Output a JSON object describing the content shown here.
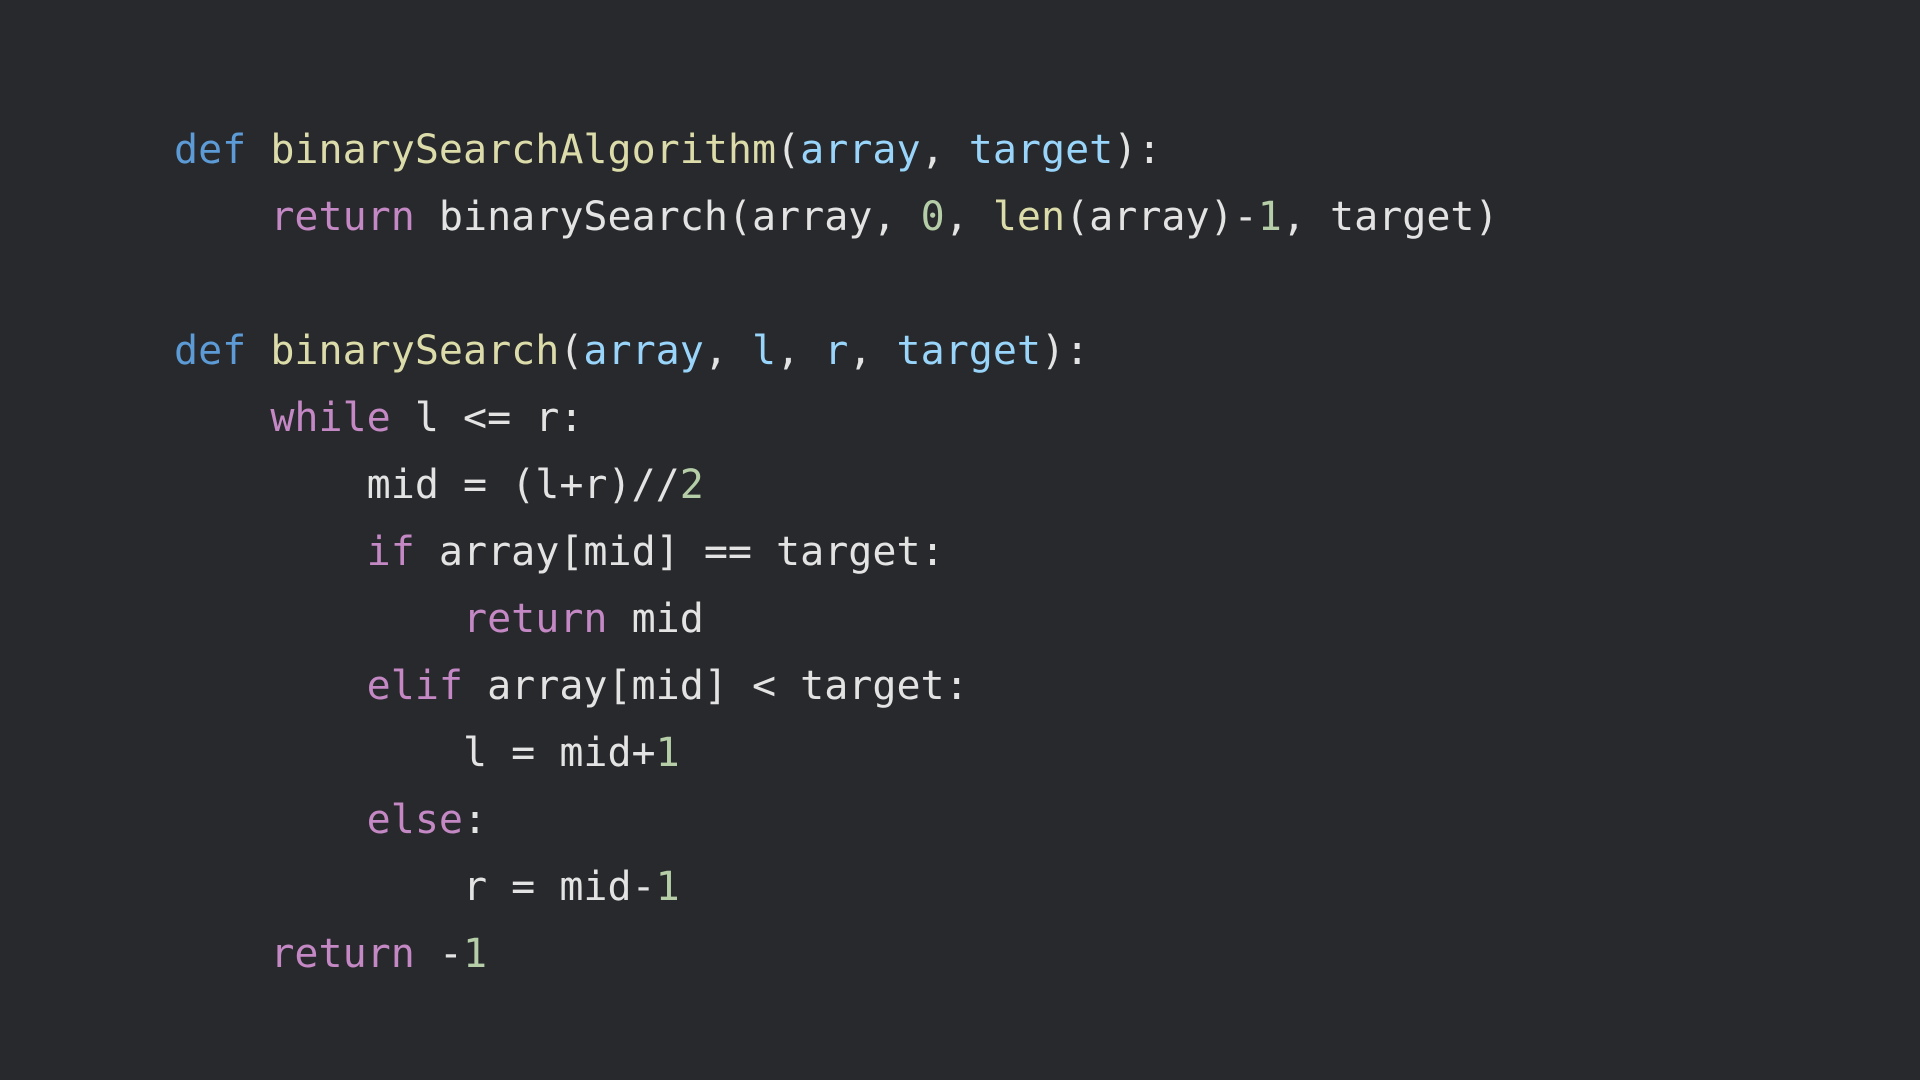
{
  "colors": {
    "background": "#28292c",
    "keyword_def": "#5d9bd6",
    "keyword_control": "#c488c5",
    "function_name": "#dcdcaa",
    "parameter": "#99d5fb",
    "number": "#b5cea8",
    "plain_text": "#e3e3e3"
  },
  "code": {
    "language": "python",
    "lines": [
      {
        "indent": 0,
        "tokens": [
          {
            "t": "def",
            "k": "kw-def"
          },
          {
            "t": " ",
            "k": "plain"
          },
          {
            "t": "binarySearchAlgorithm",
            "k": "fn"
          },
          {
            "t": "(",
            "k": "plain"
          },
          {
            "t": "array",
            "k": "param"
          },
          {
            "t": ", ",
            "k": "plain"
          },
          {
            "t": "target",
            "k": "param"
          },
          {
            "t": "):",
            "k": "plain"
          }
        ]
      },
      {
        "indent": 1,
        "tokens": [
          {
            "t": "return",
            "k": "kw"
          },
          {
            "t": " binarySearch(array, ",
            "k": "plain"
          },
          {
            "t": "0",
            "k": "num"
          },
          {
            "t": ", ",
            "k": "plain"
          },
          {
            "t": "len",
            "k": "fn"
          },
          {
            "t": "(array)-",
            "k": "plain"
          },
          {
            "t": "1",
            "k": "num"
          },
          {
            "t": ", target)",
            "k": "plain"
          }
        ]
      },
      {
        "indent": 0,
        "tokens": []
      },
      {
        "indent": 0,
        "tokens": [
          {
            "t": "def",
            "k": "kw-def"
          },
          {
            "t": " ",
            "k": "plain"
          },
          {
            "t": "binarySearch",
            "k": "fn"
          },
          {
            "t": "(",
            "k": "plain"
          },
          {
            "t": "array",
            "k": "param"
          },
          {
            "t": ", ",
            "k": "plain"
          },
          {
            "t": "l",
            "k": "param"
          },
          {
            "t": ", ",
            "k": "plain"
          },
          {
            "t": "r",
            "k": "param"
          },
          {
            "t": ", ",
            "k": "plain"
          },
          {
            "t": "target",
            "k": "param"
          },
          {
            "t": "):",
            "k": "plain"
          }
        ]
      },
      {
        "indent": 1,
        "tokens": [
          {
            "t": "while",
            "k": "kw"
          },
          {
            "t": " l <= r:",
            "k": "plain"
          }
        ]
      },
      {
        "indent": 2,
        "tokens": [
          {
            "t": "mid = (l+r)//",
            "k": "plain"
          },
          {
            "t": "2",
            "k": "num"
          }
        ]
      },
      {
        "indent": 2,
        "tokens": [
          {
            "t": "if",
            "k": "kw"
          },
          {
            "t": " array[mid] == target:",
            "k": "plain"
          }
        ]
      },
      {
        "indent": 3,
        "tokens": [
          {
            "t": "return",
            "k": "kw"
          },
          {
            "t": " mid",
            "k": "plain"
          }
        ]
      },
      {
        "indent": 2,
        "tokens": [
          {
            "t": "elif",
            "k": "kw"
          },
          {
            "t": " array[mid] < target:",
            "k": "plain"
          }
        ]
      },
      {
        "indent": 3,
        "tokens": [
          {
            "t": "l = mid+",
            "k": "plain"
          },
          {
            "t": "1",
            "k": "num"
          }
        ]
      },
      {
        "indent": 2,
        "tokens": [
          {
            "t": "else",
            "k": "kw"
          },
          {
            "t": ":",
            "k": "plain"
          }
        ]
      },
      {
        "indent": 3,
        "tokens": [
          {
            "t": "r = mid-",
            "k": "plain"
          },
          {
            "t": "1",
            "k": "num"
          }
        ]
      },
      {
        "indent": 1,
        "tokens": [
          {
            "t": "return",
            "k": "kw"
          },
          {
            "t": " -",
            "k": "plain"
          },
          {
            "t": "1",
            "k": "num"
          }
        ]
      }
    ]
  }
}
